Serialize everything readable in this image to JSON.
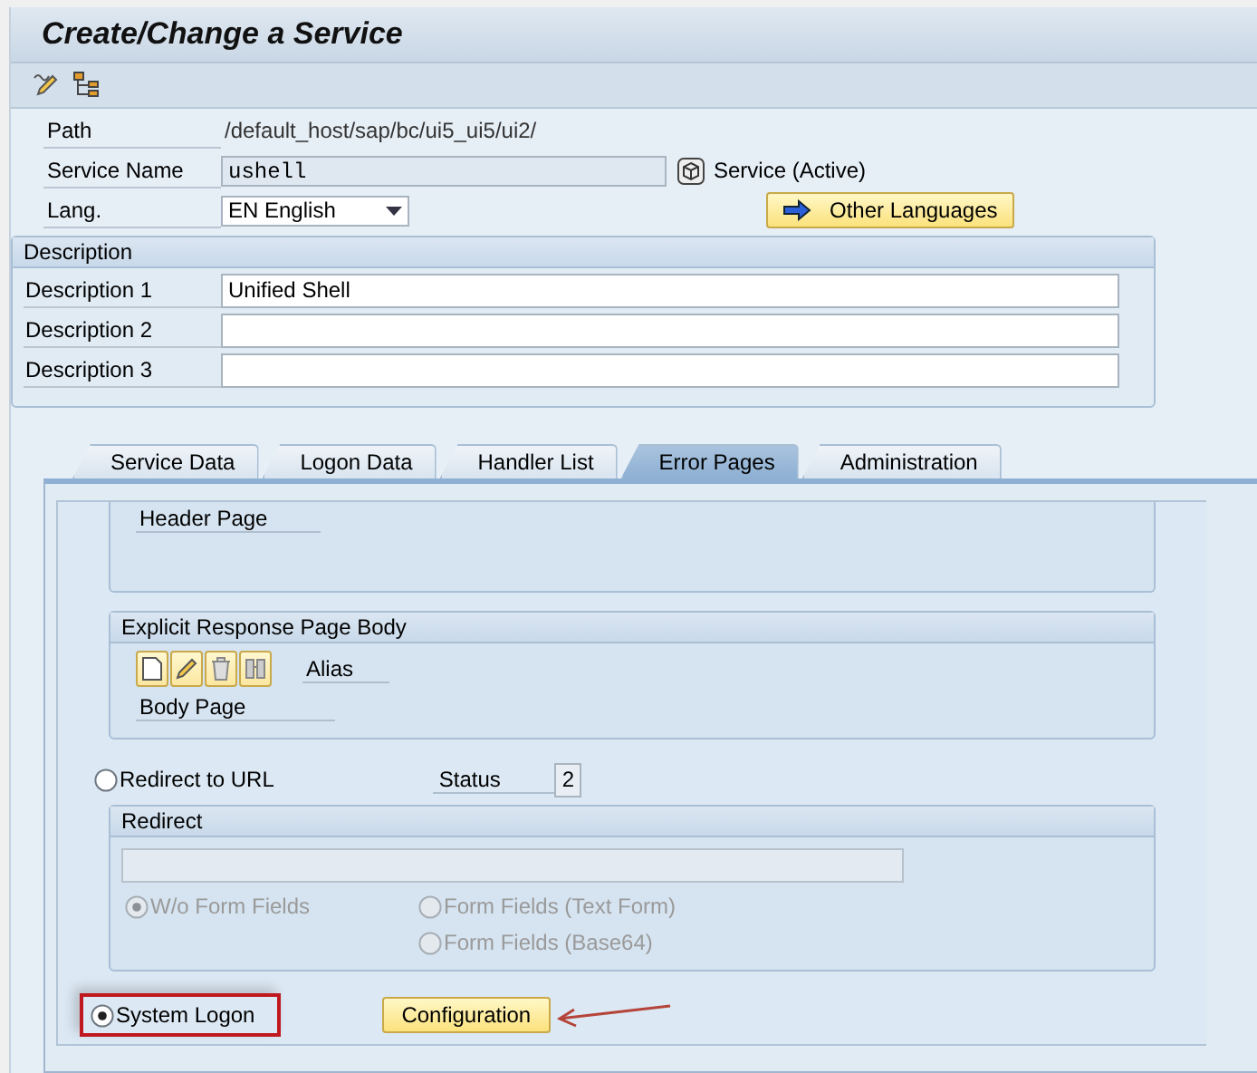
{
  "window": {
    "title": "Create/Change a Service"
  },
  "path": {
    "label": "Path",
    "value": "/default_host/sap/bc/ui5_ui5/ui2/"
  },
  "service_name": {
    "label": "Service Name",
    "value": "ushell",
    "status": "Service (Active)"
  },
  "language": {
    "label": "Lang.",
    "value": "EN English"
  },
  "other_languages_button": "Other Languages",
  "description": {
    "title": "Description",
    "rows": [
      {
        "label": "Description 1",
        "value": "Unified Shell"
      },
      {
        "label": "Description 2"
      },
      {
        "label": "Description 3"
      }
    ]
  },
  "tabs": [
    {
      "label": "Service Data",
      "selected": false
    },
    {
      "label": "Logon Data",
      "selected": false
    },
    {
      "label": "Handler List",
      "selected": false
    },
    {
      "label": "Error Pages",
      "selected": true
    },
    {
      "label": "Administration",
      "selected": false
    }
  ],
  "error_pages": {
    "header_page": {
      "label": "Header Page"
    },
    "explicit_body": {
      "title": "Explicit Response Page Body",
      "alias_label": "Alias",
      "body_page_label": "Body Page"
    },
    "redirect_option": {
      "label": "Redirect to URL",
      "selected": false
    },
    "status": {
      "label": "Status",
      "value": "2"
    },
    "redirect": {
      "title": "Redirect",
      "options": [
        {
          "label": "W/o Form Fields",
          "selected": true,
          "disabled": true
        },
        {
          "label": "Form Fields (Text Form)",
          "selected": false,
          "disabled": true
        },
        {
          "label": "Form Fields (Base64)",
          "selected": false,
          "disabled": true
        }
      ]
    },
    "system_logon": {
      "label": "System Logon",
      "selected": true,
      "highlighted": true
    },
    "configuration_button": "Configuration"
  }
}
